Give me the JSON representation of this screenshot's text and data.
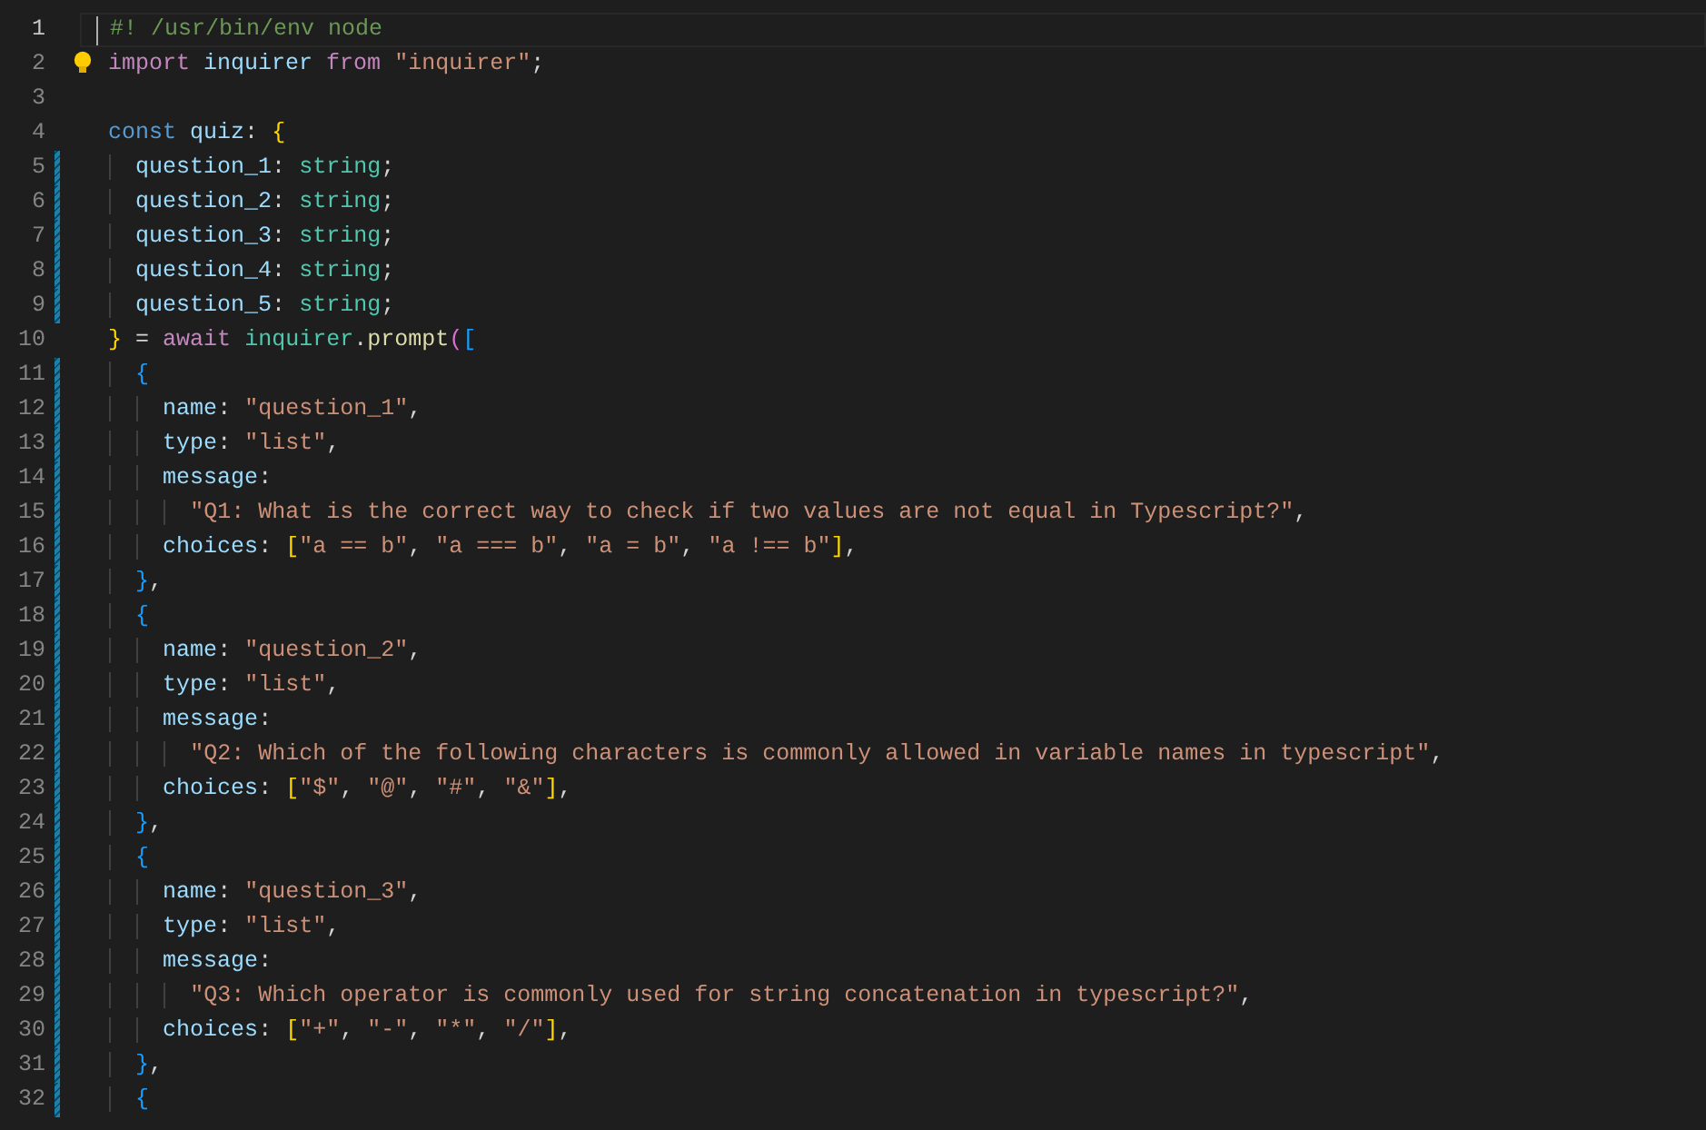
{
  "editor": {
    "lines": [
      {
        "number": "1",
        "current": true,
        "modified": false,
        "lightbulb": false,
        "tokens": [
          {
            "kind": "comment",
            "text": "#! /usr/bin/env node"
          }
        ]
      },
      {
        "number": "2",
        "current": false,
        "modified": false,
        "lightbulb": true,
        "tokens": [
          {
            "kind": "keyword",
            "text": "import "
          },
          {
            "kind": "variable",
            "text": "inquirer "
          },
          {
            "kind": "keyword",
            "text": "from "
          },
          {
            "kind": "string",
            "text": "\"inquirer\""
          },
          {
            "kind": "plain",
            "text": ";"
          }
        ]
      },
      {
        "number": "3",
        "current": false,
        "modified": false,
        "lightbulb": false
      },
      {
        "number": "4",
        "current": false,
        "modified": false,
        "lightbulb": false,
        "tokens": [
          {
            "kind": "storage",
            "text": "const "
          },
          {
            "kind": "variable",
            "text": "quiz"
          },
          {
            "kind": "plain",
            "text": ": "
          },
          {
            "kind": "bracket1",
            "text": "{"
          }
        ]
      },
      {
        "number": "5",
        "current": false,
        "modified": true,
        "lightbulb": false,
        "tokens": [
          {
            "kind": "variable",
            "text": "  question_1"
          },
          {
            "kind": "plain",
            "text": ": "
          },
          {
            "kind": "type",
            "text": "string"
          },
          {
            "kind": "plain",
            "text": ";"
          }
        ]
      },
      {
        "number": "6",
        "current": false,
        "modified": true,
        "lightbulb": false,
        "tokens": [
          {
            "kind": "variable",
            "text": "  question_2"
          },
          {
            "kind": "plain",
            "text": ": "
          },
          {
            "kind": "type",
            "text": "string"
          },
          {
            "kind": "plain",
            "text": ";"
          }
        ]
      },
      {
        "number": "7",
        "current": false,
        "modified": true,
        "lightbulb": false,
        "tokens": [
          {
            "kind": "variable",
            "text": "  question_3"
          },
          {
            "kind": "plain",
            "text": ": "
          },
          {
            "kind": "type",
            "text": "string"
          },
          {
            "kind": "plain",
            "text": ";"
          }
        ]
      },
      {
        "number": "8",
        "current": false,
        "modified": true,
        "lightbulb": false,
        "tokens": [
          {
            "kind": "variable",
            "text": "  question_4"
          },
          {
            "kind": "plain",
            "text": ": "
          },
          {
            "kind": "type",
            "text": "string"
          },
          {
            "kind": "plain",
            "text": ";"
          }
        ]
      },
      {
        "number": "9",
        "current": false,
        "modified": true,
        "lightbulb": false,
        "tokens": [
          {
            "kind": "variable",
            "text": "  question_5"
          },
          {
            "kind": "plain",
            "text": ": "
          },
          {
            "kind": "type",
            "text": "string"
          },
          {
            "kind": "plain",
            "text": ";"
          }
        ]
      },
      {
        "number": "10",
        "current": false,
        "modified": false,
        "lightbulb": false,
        "tokens": [
          {
            "kind": "bracket1",
            "text": "}"
          },
          {
            "kind": "plain",
            "text": " = "
          },
          {
            "kind": "keyword",
            "text": "await "
          },
          {
            "kind": "type",
            "text": "inquirer"
          },
          {
            "kind": "plain",
            "text": "."
          },
          {
            "kind": "function",
            "text": "prompt"
          },
          {
            "kind": "bracket2",
            "text": "("
          },
          {
            "kind": "bracket3",
            "text": "["
          }
        ]
      },
      {
        "number": "11",
        "current": false,
        "modified": true,
        "lightbulb": false,
        "tokens": [
          {
            "kind": "bracket3",
            "text": "  {"
          }
        ]
      },
      {
        "number": "12",
        "current": false,
        "modified": true,
        "lightbulb": false,
        "tokens": [
          {
            "kind": "variable",
            "text": "    name"
          },
          {
            "kind": "plain",
            "text": ": "
          },
          {
            "kind": "string",
            "text": "\"question_1\""
          },
          {
            "kind": "plain",
            "text": ","
          }
        ]
      },
      {
        "number": "13",
        "current": false,
        "modified": true,
        "lightbulb": false,
        "tokens": [
          {
            "kind": "variable",
            "text": "    type"
          },
          {
            "kind": "plain",
            "text": ": "
          },
          {
            "kind": "string",
            "text": "\"list\""
          },
          {
            "kind": "plain",
            "text": ","
          }
        ]
      },
      {
        "number": "14",
        "current": false,
        "modified": true,
        "lightbulb": false,
        "tokens": [
          {
            "kind": "variable",
            "text": "    message"
          },
          {
            "kind": "plain",
            "text": ":"
          }
        ]
      },
      {
        "number": "15",
        "current": false,
        "modified": true,
        "lightbulb": false,
        "tokens": [
          {
            "kind": "string",
            "text": "      \"Q1: What is the correct way to check if two values are not equal in Typescript?\""
          },
          {
            "kind": "plain",
            "text": ","
          }
        ]
      },
      {
        "number": "16",
        "current": false,
        "modified": true,
        "lightbulb": false,
        "tokens": [
          {
            "kind": "variable",
            "text": "    choices"
          },
          {
            "kind": "plain",
            "text": ": "
          },
          {
            "kind": "bracket1",
            "text": "["
          },
          {
            "kind": "string",
            "text": "\"a == b\""
          },
          {
            "kind": "plain",
            "text": ", "
          },
          {
            "kind": "string",
            "text": "\"a === b\""
          },
          {
            "kind": "plain",
            "text": ", "
          },
          {
            "kind": "string",
            "text": "\"a = b\""
          },
          {
            "kind": "plain",
            "text": ", "
          },
          {
            "kind": "string",
            "text": "\"a !== b\""
          },
          {
            "kind": "bracket1",
            "text": "]"
          },
          {
            "kind": "plain",
            "text": ","
          }
        ]
      },
      {
        "number": "17",
        "current": false,
        "modified": true,
        "lightbulb": false,
        "tokens": [
          {
            "kind": "bracket3",
            "text": "  }"
          },
          {
            "kind": "plain",
            "text": ","
          }
        ]
      },
      {
        "number": "18",
        "current": false,
        "modified": true,
        "lightbulb": false,
        "tokens": [
          {
            "kind": "bracket3",
            "text": "  {"
          }
        ]
      },
      {
        "number": "19",
        "current": false,
        "modified": true,
        "lightbulb": false,
        "tokens": [
          {
            "kind": "variable",
            "text": "    name"
          },
          {
            "kind": "plain",
            "text": ": "
          },
          {
            "kind": "string",
            "text": "\"question_2\""
          },
          {
            "kind": "plain",
            "text": ","
          }
        ]
      },
      {
        "number": "20",
        "current": false,
        "modified": true,
        "lightbulb": false,
        "tokens": [
          {
            "kind": "variable",
            "text": "    type"
          },
          {
            "kind": "plain",
            "text": ": "
          },
          {
            "kind": "string",
            "text": "\"list\""
          },
          {
            "kind": "plain",
            "text": ","
          }
        ]
      },
      {
        "number": "21",
        "current": false,
        "modified": true,
        "lightbulb": false,
        "tokens": [
          {
            "kind": "variable",
            "text": "    message"
          },
          {
            "kind": "plain",
            "text": ":"
          }
        ]
      },
      {
        "number": "22",
        "current": false,
        "modified": true,
        "lightbulb": false,
        "tokens": [
          {
            "kind": "string",
            "text": "      \"Q2: Which of the following characters is commonly allowed in variable names in typescript\""
          },
          {
            "kind": "plain",
            "text": ","
          }
        ]
      },
      {
        "number": "23",
        "current": false,
        "modified": true,
        "lightbulb": false,
        "tokens": [
          {
            "kind": "variable",
            "text": "    choices"
          },
          {
            "kind": "plain",
            "text": ": "
          },
          {
            "kind": "bracket1",
            "text": "["
          },
          {
            "kind": "string",
            "text": "\"$\""
          },
          {
            "kind": "plain",
            "text": ", "
          },
          {
            "kind": "string",
            "text": "\"@\""
          },
          {
            "kind": "plain",
            "text": ", "
          },
          {
            "kind": "string",
            "text": "\"#\""
          },
          {
            "kind": "plain",
            "text": ", "
          },
          {
            "kind": "string",
            "text": "\"&\""
          },
          {
            "kind": "bracket1",
            "text": "]"
          },
          {
            "kind": "plain",
            "text": ","
          }
        ]
      },
      {
        "number": "24",
        "current": false,
        "modified": true,
        "lightbulb": false,
        "tokens": [
          {
            "kind": "bracket3",
            "text": "  }"
          },
          {
            "kind": "plain",
            "text": ","
          }
        ]
      },
      {
        "number": "25",
        "current": false,
        "modified": true,
        "lightbulb": false,
        "tokens": [
          {
            "kind": "bracket3",
            "text": "  {"
          }
        ]
      },
      {
        "number": "26",
        "current": false,
        "modified": true,
        "lightbulb": false,
        "tokens": [
          {
            "kind": "variable",
            "text": "    name"
          },
          {
            "kind": "plain",
            "text": ": "
          },
          {
            "kind": "string",
            "text": "\"question_3\""
          },
          {
            "kind": "plain",
            "text": ","
          }
        ]
      },
      {
        "number": "27",
        "current": false,
        "modified": true,
        "lightbulb": false,
        "tokens": [
          {
            "kind": "variable",
            "text": "    type"
          },
          {
            "kind": "plain",
            "text": ": "
          },
          {
            "kind": "string",
            "text": "\"list\""
          },
          {
            "kind": "plain",
            "text": ","
          }
        ]
      },
      {
        "number": "28",
        "current": false,
        "modified": true,
        "lightbulb": false,
        "tokens": [
          {
            "kind": "variable",
            "text": "    message"
          },
          {
            "kind": "plain",
            "text": ":"
          }
        ]
      },
      {
        "number": "29",
        "current": false,
        "modified": true,
        "lightbulb": false,
        "tokens": [
          {
            "kind": "string",
            "text": "      \"Q3: Which operator is commonly used for string concatenation in typescript?\""
          },
          {
            "kind": "plain",
            "text": ","
          }
        ]
      },
      {
        "number": "30",
        "current": false,
        "modified": true,
        "lightbulb": false,
        "tokens": [
          {
            "kind": "variable",
            "text": "    choices"
          },
          {
            "kind": "plain",
            "text": ": "
          },
          {
            "kind": "bracket1",
            "text": "["
          },
          {
            "kind": "string",
            "text": "\"+\""
          },
          {
            "kind": "plain",
            "text": ", "
          },
          {
            "kind": "string",
            "text": "\"-\""
          },
          {
            "kind": "plain",
            "text": ", "
          },
          {
            "kind": "string",
            "text": "\"*\""
          },
          {
            "kind": "plain",
            "text": ", "
          },
          {
            "kind": "string",
            "text": "\"/\""
          },
          {
            "kind": "bracket1",
            "text": "]"
          },
          {
            "kind": "plain",
            "text": ","
          }
        ]
      },
      {
        "number": "31",
        "current": false,
        "modified": true,
        "lightbulb": false,
        "tokens": [
          {
            "kind": "bracket3",
            "text": "  }"
          },
          {
            "kind": "plain",
            "text": ","
          }
        ]
      },
      {
        "number": "32",
        "current": false,
        "modified": true,
        "lightbulb": false,
        "tokens": [
          {
            "kind": "bracket3",
            "text": "  {"
          }
        ]
      }
    ]
  }
}
